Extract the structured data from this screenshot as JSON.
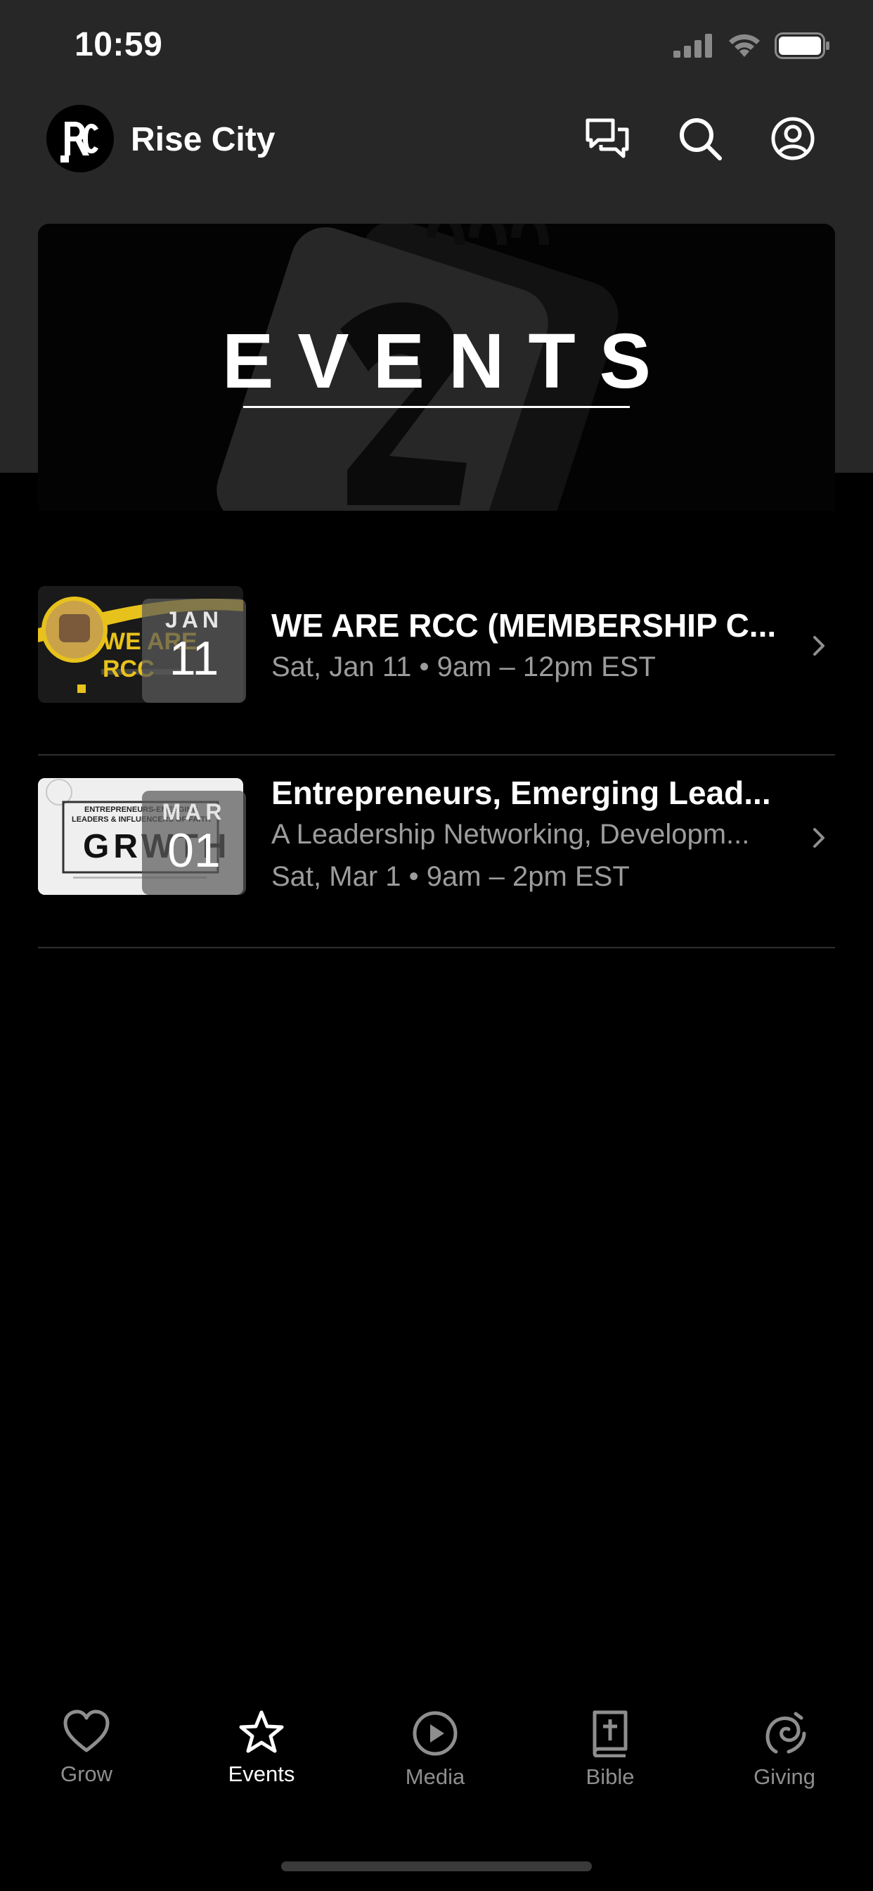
{
  "status_bar": {
    "time": "10:59"
  },
  "header": {
    "logo_text": "RC",
    "title": "Rise City"
  },
  "hero": {
    "title": "EVENTS"
  },
  "events": [
    {
      "thumb_text": "WE ARE RCC",
      "month": "JAN",
      "day": "11",
      "title": "WE ARE RCC (MEMBERSHIP C...",
      "subtitle": "",
      "datetime": "Sat, Jan 11 • 9am – 12pm EST"
    },
    {
      "thumb_text": "GRWTH",
      "thumb_caption": "ENTREPRENEURS-EMERGING LEADERS & INFLUENCERS OF FAITH",
      "month": "MAR",
      "day": "01",
      "title": "Entrepreneurs, Emerging Lead...",
      "subtitle": "A Leadership Networking, Developm...",
      "datetime": "Sat, Mar 1 • 9am – 2pm EST"
    }
  ],
  "tabs": [
    {
      "label": "Grow",
      "icon": "heart-icon",
      "active": false
    },
    {
      "label": "Events",
      "icon": "star-icon",
      "active": true
    },
    {
      "label": "Media",
      "icon": "play-circle-icon",
      "active": false
    },
    {
      "label": "Bible",
      "icon": "bible-icon",
      "active": false
    },
    {
      "label": "Giving",
      "icon": "giving-icon",
      "active": false
    }
  ],
  "colors": {
    "background": "#000000",
    "header_bg": "#272727",
    "muted_text": "#9c9c9c",
    "thumb_accent": "#e8c21c"
  }
}
